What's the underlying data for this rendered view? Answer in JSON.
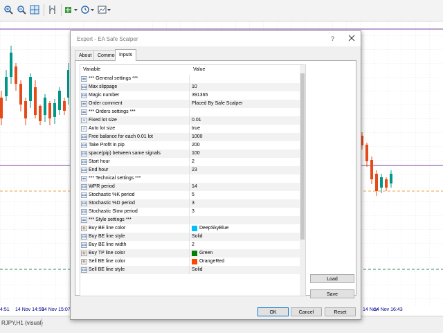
{
  "toolbar": {
    "icons": [
      "zoom-in-icon",
      "zoom-out-icon",
      "grid-icon",
      "period-separator-icon",
      "line-studies-icon",
      "clock-icon",
      "template-icon"
    ]
  },
  "chart": {
    "time_labels": [
      "4:51",
      "14 Nov 14:59",
      "14 Nov 15:07",
      "14 Nov",
      "14 Nov 16:43"
    ],
    "colors": {
      "bull": "#009688",
      "bear": "#e64a19",
      "gridline": "#d9d9d9",
      "hline_purple": "#7b3fa0",
      "hline_orange": "#e8a33d",
      "hline_green": "#2e8b57"
    }
  },
  "status": {
    "symbol": "RJPY,H1 (visual)"
  },
  "dialog": {
    "title": "Expert - EA Safe Scalper",
    "help": "?",
    "tabs": [
      {
        "label": "About",
        "active": false
      },
      {
        "label": "Common",
        "active": false
      },
      {
        "label": "Inputs",
        "active": true
      }
    ],
    "columns": {
      "variable": "Variable",
      "value": "Value"
    },
    "rows": [
      {
        "icon": "ab",
        "name": "*** General settings ***",
        "value": ""
      },
      {
        "icon": "123",
        "name": "Max slippage",
        "value": "10"
      },
      {
        "icon": "123",
        "name": "Magic number",
        "value": "391365"
      },
      {
        "icon": "ab",
        "name": "Order comment",
        "value": "Placed By Safe Scalper"
      },
      {
        "icon": "ab",
        "name": "*** Orders settings ***",
        "value": ""
      },
      {
        "icon": "½",
        "name": "Fixed lot size",
        "value": "0.01"
      },
      {
        "icon": "✓",
        "name": "Auto lot size",
        "value": "true"
      },
      {
        "icon": "123",
        "name": "Free balance for each 0.01 lot",
        "value": "1000"
      },
      {
        "icon": "123",
        "name": "Take Profit in pip",
        "value": "200"
      },
      {
        "icon": "123",
        "name": "space(pip) between same signals",
        "value": "100"
      },
      {
        "icon": "123",
        "name": "Start hour",
        "value": "2"
      },
      {
        "icon": "123",
        "name": "End hour",
        "value": "23"
      },
      {
        "icon": "ab",
        "name": "*** Technical settings ***",
        "value": ""
      },
      {
        "icon": "123",
        "name": "WPR period",
        "value": "14"
      },
      {
        "icon": "123",
        "name": "Stochastic %K period",
        "value": "5"
      },
      {
        "icon": "123",
        "name": "Stochastic %D period",
        "value": "3"
      },
      {
        "icon": "123",
        "name": "Stochastic Slow period",
        "value": "3"
      },
      {
        "icon": "ab",
        "name": "*** Style settings ***",
        "value": ""
      },
      {
        "icon": "🎨",
        "name": "Buy BE line color",
        "value": "DeepSkyBlue",
        "swatch": "#00bfff"
      },
      {
        "icon": "123",
        "name": "Buy BE line style",
        "value": "Solid"
      },
      {
        "icon": "123",
        "name": "Buy BE line width",
        "value": "2"
      },
      {
        "icon": "🎨",
        "name": "Buy TP line color",
        "value": "Green",
        "swatch": "#008000"
      },
      {
        "icon": "🎨",
        "name": "Sell BE line color",
        "value": "OrangeRed",
        "swatch": "#ff4500"
      },
      {
        "icon": "123",
        "name": "Sell BE line style",
        "value": "Solid"
      }
    ],
    "buttons": {
      "load": "Load",
      "save": "Save",
      "ok": "OK",
      "cancel": "Cancel",
      "reset": "Reset"
    }
  }
}
